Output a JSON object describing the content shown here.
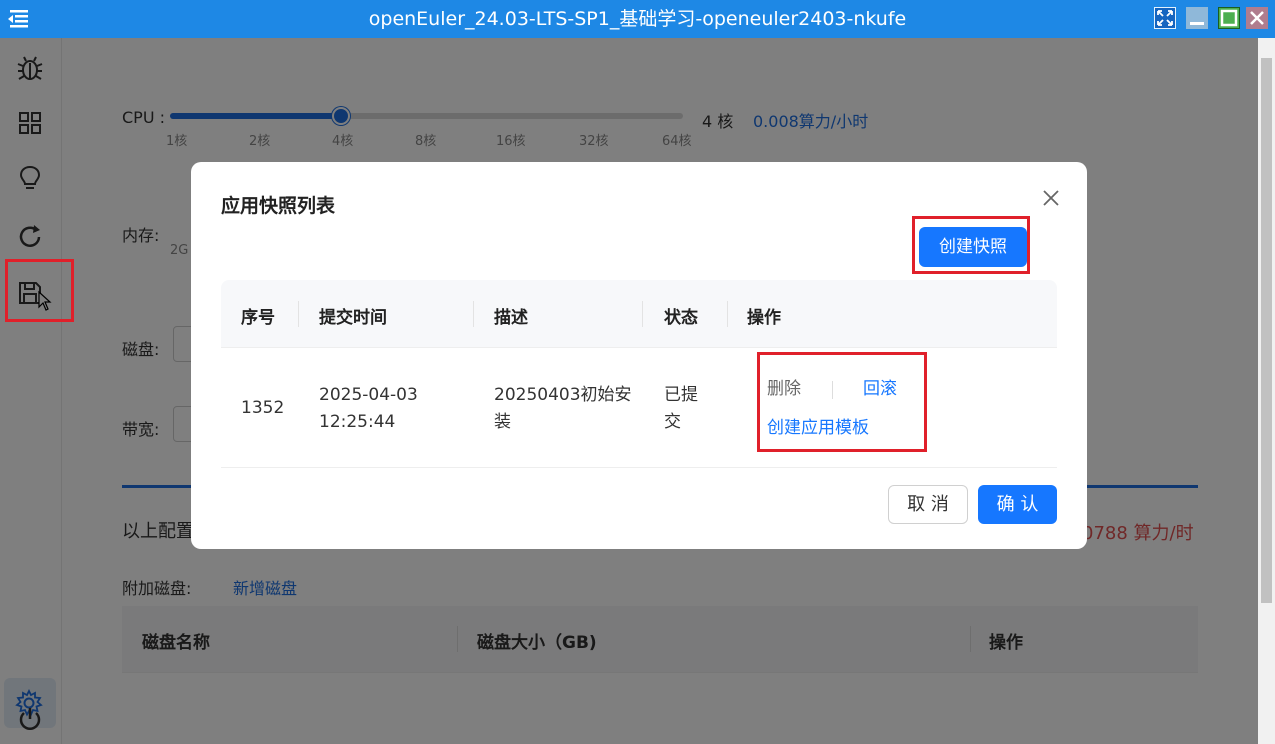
{
  "window": {
    "title": "openEuler_24.03-LTS-SP1_基础学习-openeuler2403-nkufe"
  },
  "sidebar": {
    "items": [
      "bug-icon",
      "grid-icon",
      "bulb-icon",
      "refresh-icon",
      "save-icon",
      "gear-icon",
      "power-icon"
    ]
  },
  "config": {
    "cpu_label": "CPU :",
    "cpu_value": "4 核",
    "cpu_price": "0.008算力/小时",
    "cpu_ticks": [
      "1核",
      "2核",
      "4核",
      "8核",
      "16核",
      "32核",
      "64核"
    ],
    "cpu_level": 0.333,
    "memory_label": "内存:",
    "memory_tick": "2G",
    "disk_label": "磁盘:",
    "bandwidth_label": "带宽:",
    "summary_prefix": "以上配置",
    "summary_price": "0788 算力/时",
    "extra_disk_label": "附加磁盘:",
    "add_disk_link": "新增磁盘",
    "disk_table_headers": [
      "磁盘名称",
      "磁盘大小（GB)",
      "操作"
    ]
  },
  "modal": {
    "title": "应用快照列表",
    "create_button": "创建快照",
    "headers": [
      "序号",
      "提交时间",
      "描述",
      "状态",
      "操作"
    ],
    "rows": [
      {
        "id": "1352",
        "time_line1": "2025-04-03",
        "time_line2": "12:25:44",
        "desc_line1": "20250403初始安",
        "desc_line2": "装",
        "status_line1": "已提",
        "status_line2": "交",
        "op_delete": "删除",
        "op_rollback": "回滚",
        "op_template": "创建应用模板"
      }
    ],
    "cancel_button": "取 消",
    "ok_button": "确 认"
  },
  "colors": {
    "titlebar": "#1e88e5",
    "primary": "#1677ff",
    "highlight": "#e0202a",
    "price_red": "#e05050"
  }
}
